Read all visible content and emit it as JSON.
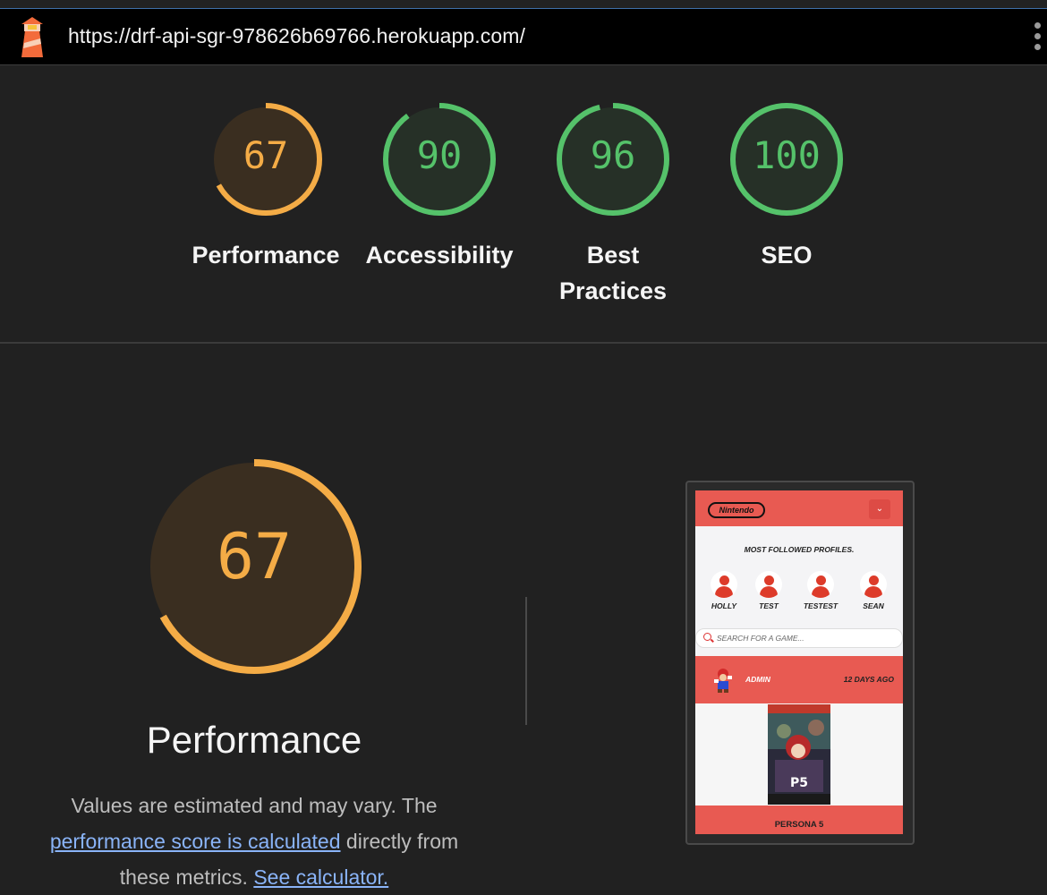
{
  "browser": {
    "url": "https://drf-api-sgr-978626b69766.herokuapp.com/",
    "favicon": "lighthouse-icon",
    "menu_icon": "kebab-menu-icon"
  },
  "scores": [
    {
      "id": "performance",
      "value": "67",
      "label": "Performance",
      "score": 0.67,
      "status": "average"
    },
    {
      "id": "accessibility",
      "value": "90",
      "label": "Accessibility",
      "score": 0.9,
      "status": "pass"
    },
    {
      "id": "best-practices",
      "value": "96",
      "label": "Best Practices",
      "score": 0.96,
      "status": "pass"
    },
    {
      "id": "seo",
      "value": "100",
      "label": "SEO",
      "score": 1.0,
      "status": "pass"
    }
  ],
  "colors": {
    "average": "#f4ac46",
    "average_bg": "#3a2e20",
    "pass": "#55c26a",
    "pass_bg": "#263027",
    "link": "#8ab4f8",
    "app_red": "#e85a52"
  },
  "detail": {
    "score": "67",
    "score_fraction": 0.67,
    "title": "Performance",
    "desc_before": "Values are estimated and may vary. The ",
    "desc_link": "performance score is calculated",
    "desc_middle": " directly from these metrics. ",
    "desc_link2": "See calculator."
  },
  "screenshot": {
    "logo": "Nintendo",
    "toggle_icon": "chevron-down-icon",
    "heading": "MOST FOLLOWED PROFILES.",
    "profiles": [
      "HOLLY",
      "TEST",
      "TESTEST",
      "SEAN"
    ],
    "search_placeholder": "SEARCH FOR A GAME...",
    "post": {
      "author": "ADMIN",
      "date": "12 DAYS AGO",
      "title": "PERSONA 5"
    }
  }
}
